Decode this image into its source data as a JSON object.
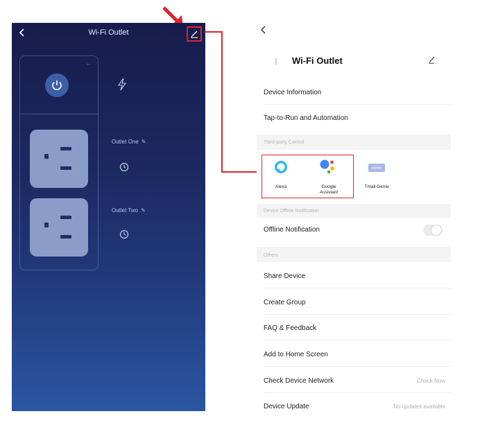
{
  "left_screen": {
    "title": "Wi-Fi Outlet",
    "outlets": [
      {
        "label": "Outlet One"
      },
      {
        "label": "Outlet Two"
      }
    ]
  },
  "right_screen": {
    "title": "Wi-Fi Outlet",
    "menu": {
      "device_information": "Device Information",
      "tap_to_run": "Tap-to-Run and Automation"
    },
    "third_party": {
      "header": "Third-party Control",
      "items": [
        {
          "label": "Alexa",
          "icon": "alexa-icon"
        },
        {
          "label": "Google\nAssistant",
          "icon": "google-assistant-icon"
        },
        {
          "label": "Tmall Genie",
          "icon": "tmall-genie-icon"
        }
      ]
    },
    "offline": {
      "header": "Device Offline Notification",
      "label": "Offline Notification",
      "toggle_on": false
    },
    "others": {
      "header": "Others",
      "items": [
        {
          "label": "Share Device",
          "value": ""
        },
        {
          "label": "Create Group",
          "value": ""
        },
        {
          "label": "FAQ & Feedback",
          "value": ""
        },
        {
          "label": "Add to Home Screen",
          "value": ""
        },
        {
          "label": "Check Device Network",
          "value": "Check Now"
        },
        {
          "label": "Device Update",
          "value": "No updates available"
        }
      ]
    }
  },
  "colors": {
    "highlight": "#e0232a",
    "left_bg_top": "#171c4c",
    "left_bg_bottom": "#2a56a2",
    "socket": "#8a9cc8",
    "power_button": "#3d5fa8"
  }
}
